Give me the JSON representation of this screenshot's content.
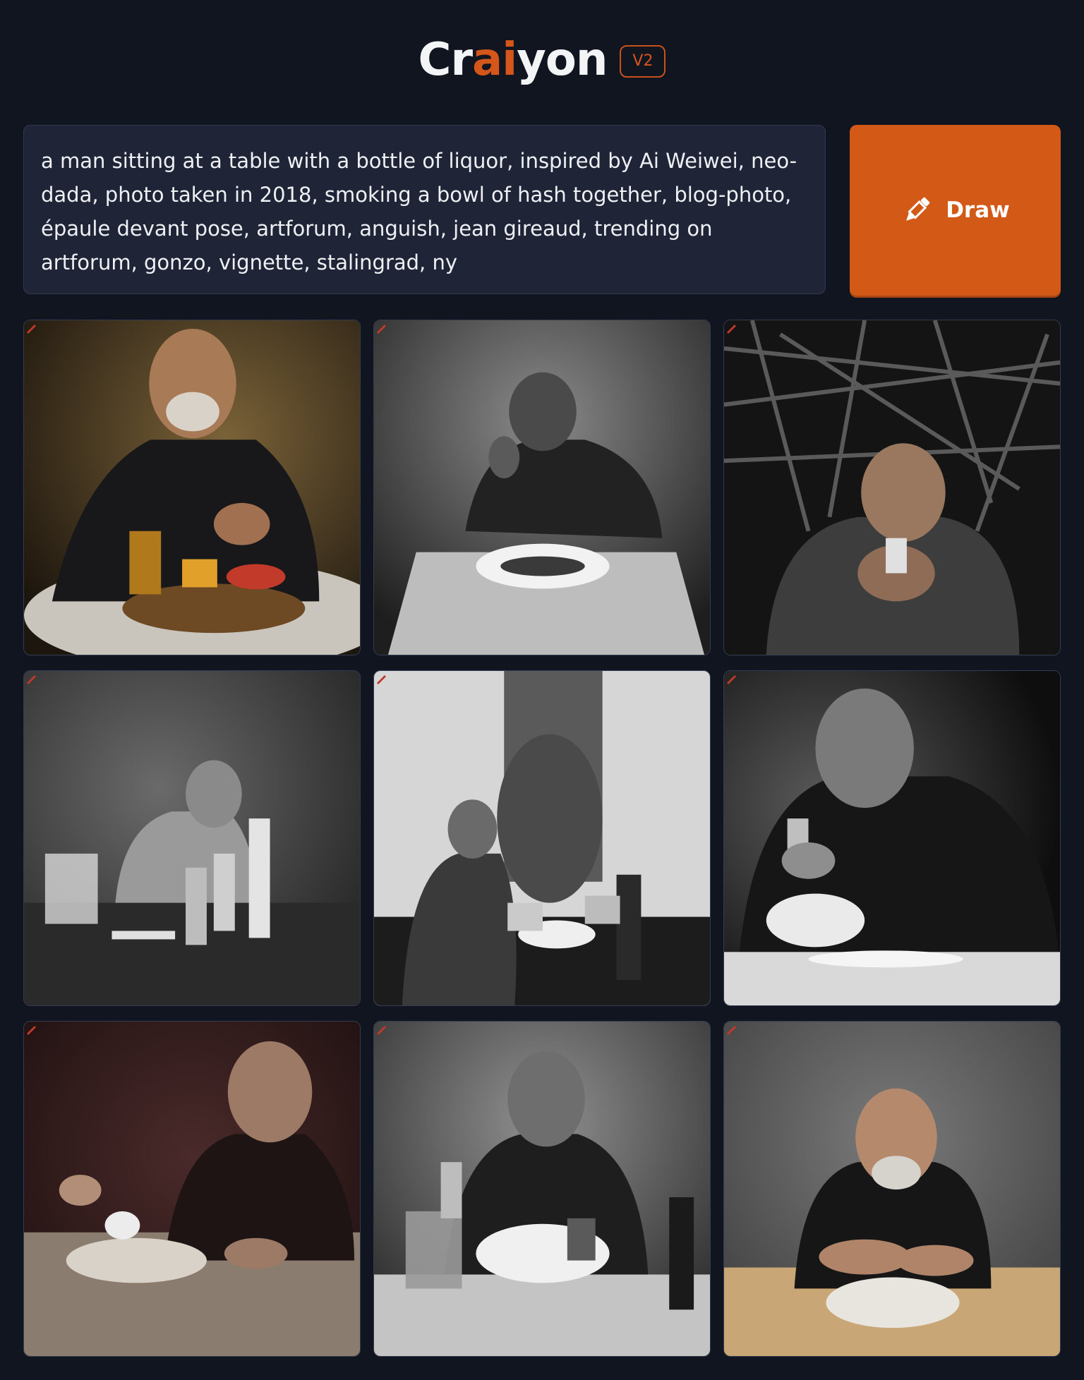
{
  "header": {
    "logo_part1": "Cr",
    "logo_part2": "ai",
    "logo_part3": "yon",
    "version_badge": "V2"
  },
  "prompt": {
    "text": "a man sitting at a table with a bottle of liquor, inspired by Ai Weiwei, neo-dada, photo taken in 2018, smoking a bowl of hash together, blog-photo, épaule devant pose, artforum, anguish, jean gireaud, trending on artforum, gonzo, vignette, stalingrad, ny"
  },
  "draw_button": {
    "label": "Draw",
    "icon": "pencil-icon"
  },
  "colors": {
    "background": "#111520",
    "accent": "#d35916",
    "prompt_bg": "#1f2536"
  },
  "results": {
    "count": 9,
    "watermark_icon": "crayon-watermark-icon"
  }
}
